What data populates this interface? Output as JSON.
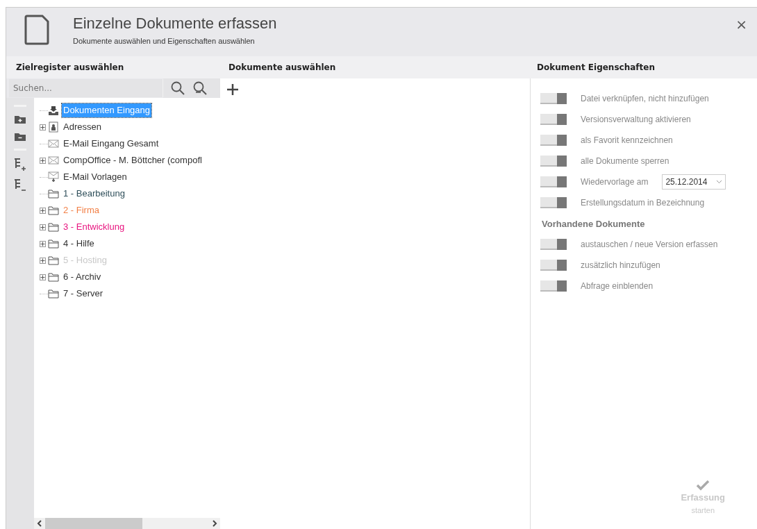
{
  "window": {
    "title": "Einzelne Dokumente erfassen",
    "subtitle": "Dokumente auswählen und Eigenschaften auswählen",
    "close": "×"
  },
  "target_panel": {
    "heading": "Zielregister auswählen",
    "search": {
      "placeholder": "Suchen..."
    },
    "tree": [
      {
        "label": "Dokumenten Eingang",
        "kind": "inbox",
        "expandable": false,
        "selected": true
      },
      {
        "label": "Adressen",
        "kind": "contact",
        "expandable": true,
        "selected": false,
        "color": "#333333"
      },
      {
        "label": "E-Mail Eingang Gesamt",
        "kind": "mail",
        "expandable": false,
        "selected": false,
        "color": "#333333"
      },
      {
        "label": "CompOffice - M. Böttcher (compofl",
        "kind": "mail",
        "expandable": true,
        "selected": false,
        "color": "#333333"
      },
      {
        "label": "E-Mail Vorlagen",
        "kind": "template",
        "expandable": false,
        "selected": false,
        "color": "#333333"
      },
      {
        "label": "1 - Bearbeitung",
        "kind": "folder",
        "expandable": false,
        "selected": false,
        "color": "#2f4f5a"
      },
      {
        "label": "2 - Firma",
        "kind": "folder",
        "expandable": true,
        "selected": false,
        "color": "#f27f45"
      },
      {
        "label": "3 - Entwicklung",
        "kind": "folder",
        "expandable": true,
        "selected": false,
        "color": "#e8147f"
      },
      {
        "label": "4 - Hilfe",
        "kind": "folder",
        "expandable": true,
        "selected": false,
        "color": "#333333"
      },
      {
        "label": "5 - Hosting",
        "kind": "folder",
        "expandable": true,
        "selected": false,
        "color": "#c8c8c8"
      },
      {
        "label": "6 - Archiv",
        "kind": "folder",
        "expandable": true,
        "selected": false,
        "color": "#333333"
      },
      {
        "label": "7 - Server",
        "kind": "folder",
        "expandable": false,
        "selected": false,
        "color": "#333333"
      }
    ]
  },
  "documents_panel": {
    "heading": "Dokumente auswählen"
  },
  "properties_panel": {
    "heading": "Dokument Eigenschaften",
    "options": [
      {
        "label": "Datei verknüpfen, nicht hinzufügen",
        "on": true
      },
      {
        "label": "Versionsverwaltung aktivieren",
        "on": true
      },
      {
        "label": "als Favorit kennzeichnen",
        "on": true
      },
      {
        "label": "alle Dokumente sperren",
        "on": true
      },
      {
        "label": "Wiedervorlage am",
        "on": true,
        "date": "25.12.2014"
      },
      {
        "label": "Erstellungsdatum in Bezeichnung",
        "on": true
      }
    ],
    "existing_heading": "Vorhandene Dokumente",
    "existing_options": [
      {
        "label": "austauschen / neue Version erfassen",
        "on": true
      },
      {
        "label": "zusätzlich hinzufügen",
        "on": true
      },
      {
        "label": "Abfrage einblenden",
        "on": true
      }
    ],
    "start_button": {
      "label": "Erfassung",
      "sublabel": "starten",
      "disabled": true
    }
  }
}
